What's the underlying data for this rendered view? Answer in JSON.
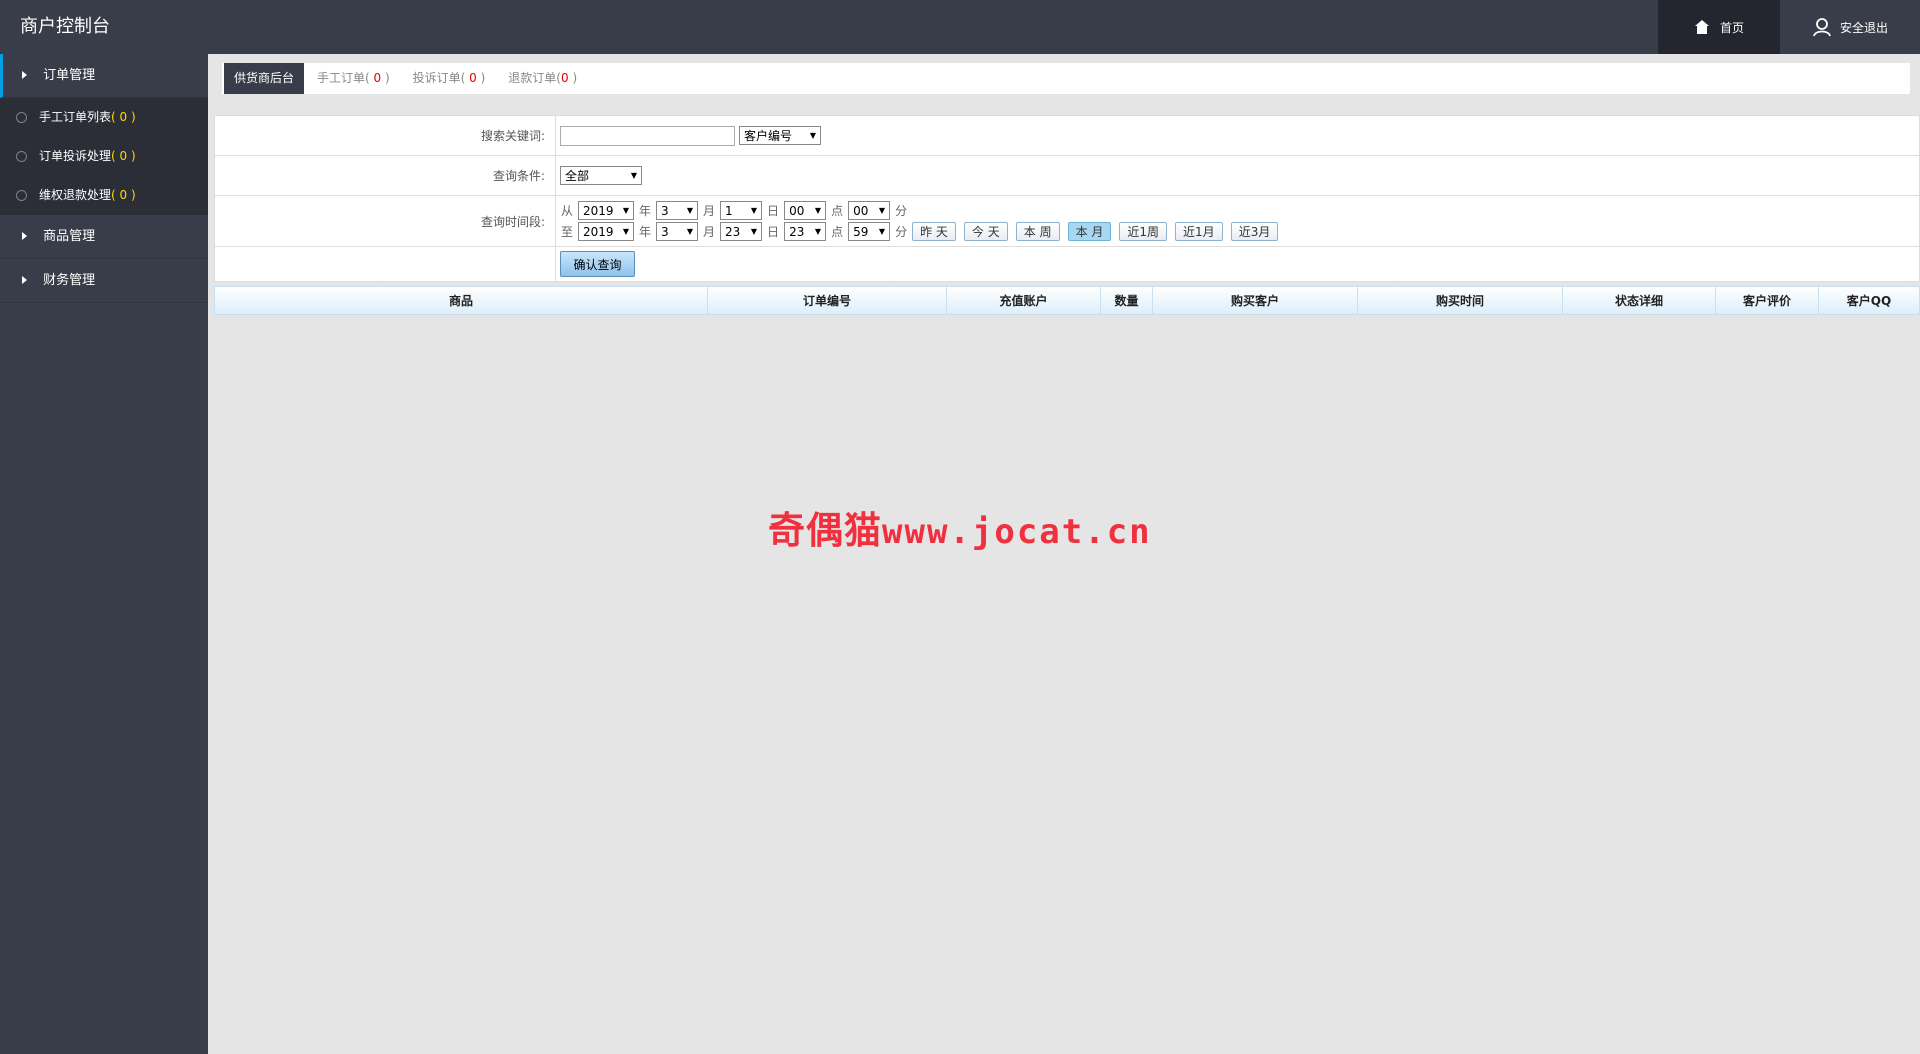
{
  "header": {
    "title": "商户控制台",
    "home_label": "首页",
    "logout_label": "安全退出"
  },
  "sidebar": {
    "order_group": "订单管理",
    "items": [
      {
        "label": "手工订单列表",
        "count": "( 0 )"
      },
      {
        "label": "订单投诉处理",
        "count": "( 0 )"
      },
      {
        "label": "维权退款处理",
        "count": "( 0 )"
      }
    ],
    "goods_group": "商品管理",
    "finance_group": "财务管理"
  },
  "tabs": {
    "active": "供货商后台",
    "manual_label": "手工订单(",
    "manual_count": " 0 ",
    "complaint_label": "投诉订单(",
    "complaint_count": " 0 ",
    "refund_label": "退款订单(",
    "refund_count": "0",
    "close_paren": " )"
  },
  "search": {
    "keyword_label": "搜索关键词:",
    "keyword_value": "",
    "keyword_type": "客户编号",
    "condition_label": "查询条件:",
    "condition_value": "全部",
    "time_label": "查询时间段:",
    "from_label": "从",
    "to_label": "至",
    "unit_year": "年",
    "unit_month": "月",
    "unit_day": "日",
    "unit_hour": "点",
    "unit_minute": "分",
    "from": {
      "year": "2019",
      "month": "3",
      "day": "1",
      "hour": "00",
      "minute": "00"
    },
    "to": {
      "year": "2019",
      "month": "3",
      "day": "23",
      "hour": "23",
      "minute": "59"
    },
    "quick": [
      "昨 天",
      "今 天",
      "本 周",
      "本 月",
      "近1周",
      "近1月",
      "近3月"
    ],
    "quick_active_index": 3,
    "submit_label": "确认查询"
  },
  "table": {
    "columns": [
      "商品",
      "订单编号",
      "充值账户",
      "数量",
      "购买客户",
      "购买时间",
      "状态详细",
      "客户评价",
      "客户QQ"
    ]
  },
  "watermark": {
    "cn": "奇偶猫",
    "url": "www.jocat.cn"
  },
  "colors": {
    "topbar": "#393d49",
    "accent": "#009fe8",
    "count_highlight": "#ffd800",
    "count_red": "#e60000"
  }
}
